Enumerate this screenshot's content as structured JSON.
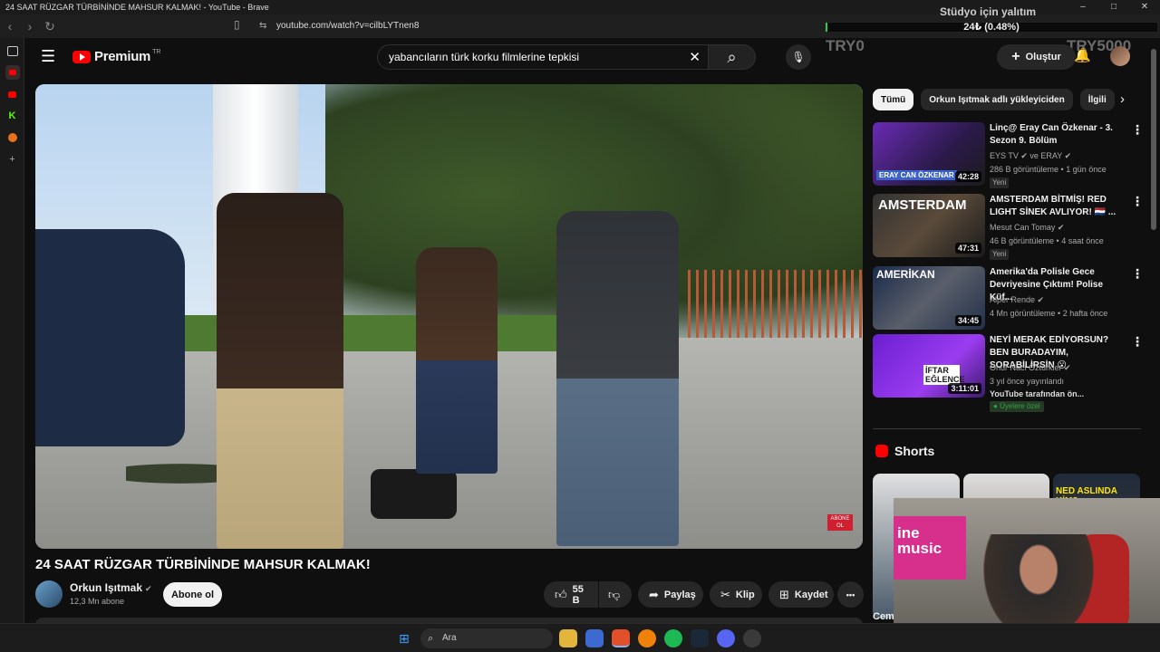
{
  "window": {
    "title": "24 SAAT RÜZGAR TÜRBİNİNDE MAHSUR KALMAK! - YouTube - Brave",
    "min": "–",
    "max": "□",
    "close": "✕"
  },
  "browser": {
    "back": "‹",
    "forward": "›",
    "reload": "↻",
    "bookmark": "▯",
    "url": "youtube.com/watch?v=cilbLYTnen8",
    "site_icon": "⇆",
    "new_tab": "+"
  },
  "overlay": {
    "label": "Stüdyo için yalıtım",
    "progress_text": "24₺ (0.48%)",
    "progress": 0.0048,
    "goal_start": "TRY0",
    "goal_end": "TRY5000"
  },
  "sidebar": [
    "panel-icon",
    "youtube-icon",
    "youtube-music-icon",
    "kick-icon",
    "firefox-icon"
  ],
  "header": {
    "logo": "Premium",
    "region": "TR",
    "search_value": "yabancıların türk korku filmlerine tepkisi",
    "clear_icon": "✕",
    "search_icon": "⌕",
    "mic_icon": "🎙",
    "create_label": "Oluştur",
    "create_icon": "+",
    "bell_icon": "🔔"
  },
  "video": {
    "title": "24 SAAT RÜZGAR TÜRBİNİNDE MAHSUR KALMAK!",
    "channel": "Orkun Işıtmak",
    "verified": "✔",
    "subscribers": "12,3 Mn abone",
    "subscribe_label": "Abone ol",
    "likes": "55 B",
    "share_label": "Paylaş",
    "clip_label": "Klip",
    "save_label": "Kaydet",
    "more": "•••",
    "badge": "ABONE OL"
  },
  "chips": [
    "Tümü",
    "Orkun Işıtmak adlı yükleyiciden",
    "İlgili"
  ],
  "recommendations": [
    {
      "title": "Linç@ Eray Can Özkenar - 3. Sezon 9. Bölüm",
      "channel": "EYS TV ✔ ve ERAY ✔",
      "meta": "286 B görüntüleme • 1 gün önce",
      "tag": "Yeni",
      "duration": "42:28",
      "thumb_text": "ERAY CAN ÖZKENAR"
    },
    {
      "title": "AMSTERDAM BİTMİŞ! RED LIGHT SİNEK AVLIYOR! 🇳🇱 ...",
      "channel": "Mesut Can Tomay ✔",
      "meta": "46 B görüntüleme • 4 saat önce",
      "tag": "Yeni",
      "duration": "47:31",
      "thumb_text": "AMSTERDAM"
    },
    {
      "title": "Amerika'da Polisle Gece Devriyesine Çıktım! Polise Küf...",
      "channel": "Alper Rende ✔",
      "meta": "4 Mn görüntüleme • 2 hafta önce",
      "duration": "34:45",
      "thumb_text": "AMERİKAN"
    },
    {
      "title": "NEYİ MERAK EDİYORSUN? BEN BURADAYIM, SORABİLİRSİN 😮",
      "channel": "Onur Naci Öztürkler ✔",
      "meta": "3 yıl önce yayınlandı",
      "sub_meta": "YouTube tarafından ön...",
      "members": "Üyelere özel",
      "duration": "3:11:01",
      "thumb_text": "İFTAR EĞLENCE"
    }
  ],
  "shorts": {
    "title": "Shorts",
    "third_text": "NED ASLINDA KİM?",
    "partial_label": "Cem"
  },
  "cam": {
    "sign": "ine music"
  },
  "taskbar": {
    "search_label": "Ara",
    "start_icon": "⊞",
    "search_icon": "⌕"
  }
}
